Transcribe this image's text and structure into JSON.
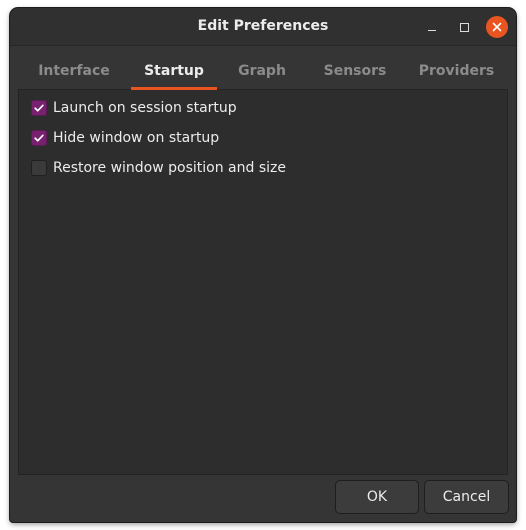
{
  "window": {
    "title": "Edit Preferences",
    "accent_color": "#e95420",
    "check_color": "#77216f"
  },
  "titlebar_buttons": {
    "minimize_icon": "minimize-icon",
    "maximize_icon": "maximize-icon",
    "close_icon": "close-icon"
  },
  "tabs": [
    {
      "label": "Interface",
      "active": false
    },
    {
      "label": "Startup",
      "active": true
    },
    {
      "label": "Graph",
      "active": false
    },
    {
      "label": "Sensors",
      "active": false
    },
    {
      "label": "Providers",
      "active": false
    }
  ],
  "startup": {
    "options": [
      {
        "label": "Launch on session startup",
        "checked": true
      },
      {
        "label": "Hide window on startup",
        "checked": true
      },
      {
        "label": "Restore window position and size",
        "checked": false
      }
    ]
  },
  "footer": {
    "ok_label": "OK",
    "cancel_label": "Cancel"
  }
}
